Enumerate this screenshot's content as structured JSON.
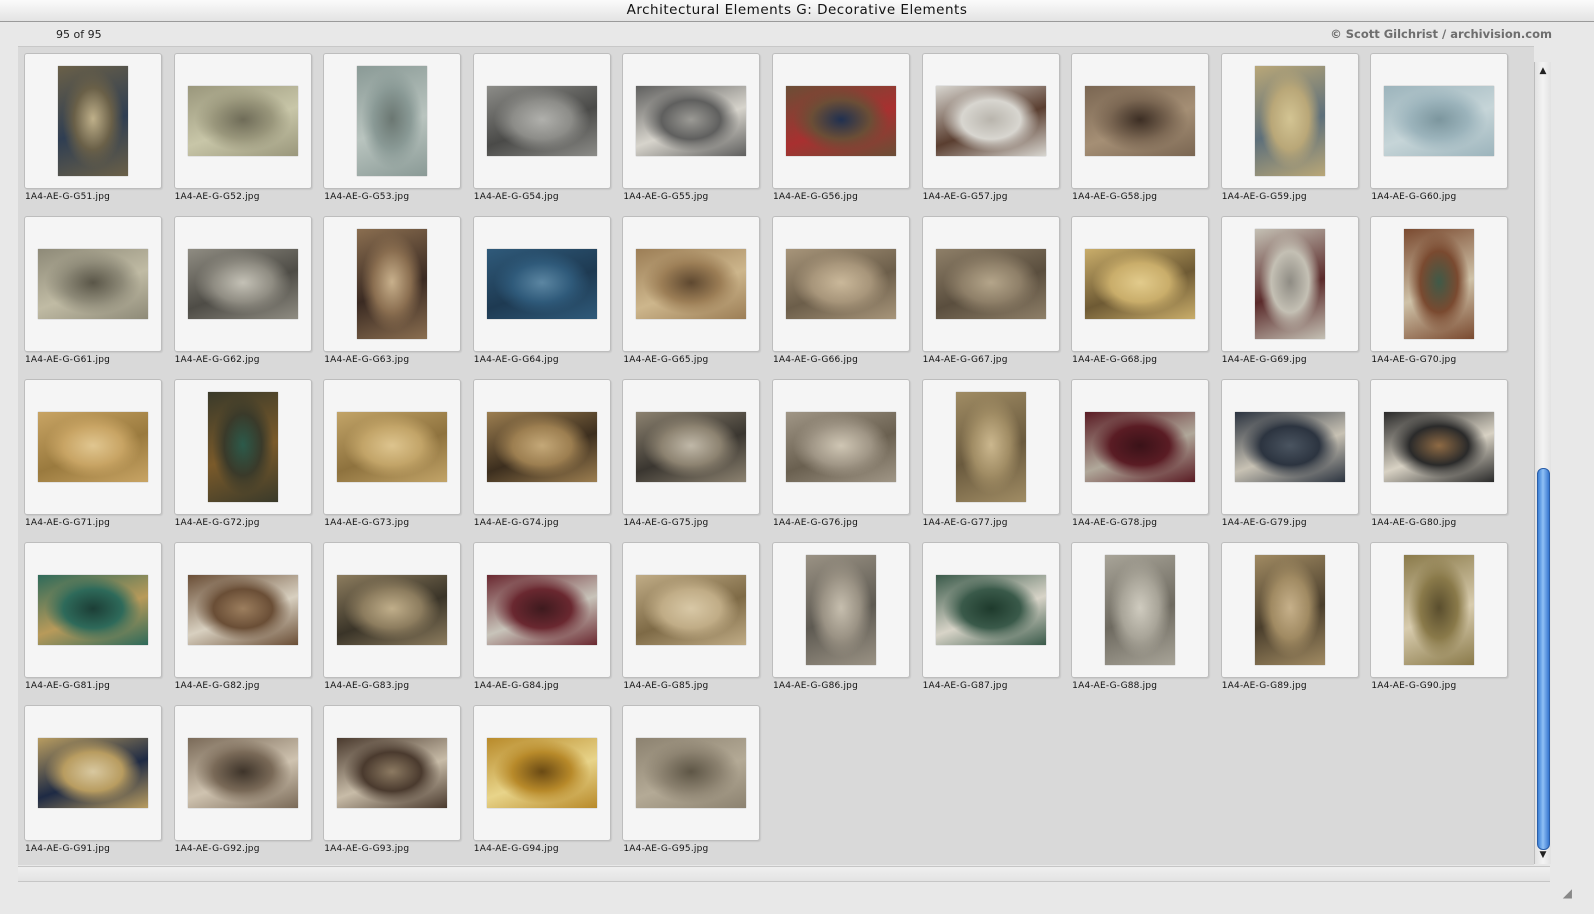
{
  "window": {
    "title": "Architectural Elements G: Decorative Elements"
  },
  "infobar": {
    "count": "95 of 95",
    "credit": "© Scott Gilchrist / archivision.com"
  },
  "scrollbar": {
    "up_glyph": "▲",
    "down_glyph": "▼",
    "resize_glyph": "◢"
  },
  "thumbnails": [
    {
      "file": "1A4-AE-G-G51.jpg",
      "shape": "port",
      "colors": [
        "#6a6048",
        "#2f3e52",
        "#bfb08a"
      ]
    },
    {
      "file": "1A4-AE-G-G52.jpg",
      "shape": "land",
      "colors": [
        "#9a977c",
        "#c8c6a8",
        "#6f6c58"
      ]
    },
    {
      "file": "1A4-AE-G-G53.jpg",
      "shape": "port",
      "colors": [
        "#8a9a96",
        "#b9c4bf",
        "#6b7772"
      ]
    },
    {
      "file": "1A4-AE-G-G54.jpg",
      "shape": "land",
      "colors": [
        "#8c8c88",
        "#4a4a48",
        "#b0b0ac"
      ]
    },
    {
      "file": "1A4-AE-G-G55.jpg",
      "shape": "land",
      "colors": [
        "#5f5f5e",
        "#d7d4cc",
        "#9b9a95"
      ]
    },
    {
      "file": "1A4-AE-G-G56.jpg",
      "shape": "land",
      "colors": [
        "#6b4e36",
        "#a83030",
        "#203050"
      ]
    },
    {
      "file": "1A4-AE-G-G57.jpg",
      "shape": "land",
      "colors": [
        "#d8d6d0",
        "#5a3e30",
        "#b9b5ad"
      ]
    },
    {
      "file": "1A4-AE-G-G58.jpg",
      "shape": "land",
      "colors": [
        "#7a6652",
        "#a58f75",
        "#3c2e24"
      ]
    },
    {
      "file": "1A4-AE-G-G59.jpg",
      "shape": "port",
      "colors": [
        "#b9a778",
        "#5d6f7a",
        "#d3c493"
      ]
    },
    {
      "file": "1A4-AE-G-G60.jpg",
      "shape": "land",
      "colors": [
        "#9cb4bc",
        "#c6d5d8",
        "#7c969e"
      ]
    },
    {
      "file": "1A4-AE-G-G61.jpg",
      "shape": "land",
      "colors": [
        "#8e8a78",
        "#c0bba4",
        "#5a5648"
      ]
    },
    {
      "file": "1A4-AE-G-G62.jpg",
      "shape": "land",
      "colors": [
        "#8f8c82",
        "#4e4c46",
        "#c4c1b6"
      ]
    },
    {
      "file": "1A4-AE-G-G63.jpg",
      "shape": "port",
      "colors": [
        "#8a6e50",
        "#3a2a22",
        "#c8b08c"
      ]
    },
    {
      "file": "1A4-AE-G-G64.jpg",
      "shape": "land",
      "colors": [
        "#2f5a7a",
        "#1e3a52",
        "#5c86a2"
      ]
    },
    {
      "file": "1A4-AE-G-G65.jpg",
      "shape": "land",
      "colors": [
        "#9c7e56",
        "#cdb68c",
        "#5e4830"
      ]
    },
    {
      "file": "1A4-AE-G-G66.jpg",
      "shape": "land",
      "colors": [
        "#a7957a",
        "#6c5e4a",
        "#cab89a"
      ]
    },
    {
      "file": "1A4-AE-G-G67.jpg",
      "shape": "land",
      "colors": [
        "#8e7f68",
        "#5a4e3e",
        "#b4a58a"
      ]
    },
    {
      "file": "1A4-AE-G-G68.jpg",
      "shape": "land",
      "colors": [
        "#c9ad6a",
        "#6e5a34",
        "#e2cb8c"
      ]
    },
    {
      "file": "1A4-AE-G-G69.jpg",
      "shape": "port",
      "colors": [
        "#c4c0b4",
        "#5a2a2a",
        "#8f8c84"
      ]
    },
    {
      "file": "1A4-AE-G-G70.jpg",
      "shape": "port",
      "colors": [
        "#7a4a30",
        "#cfc2a8",
        "#3f5a48"
      ]
    },
    {
      "file": "1A4-AE-G-G71.jpg",
      "shape": "land",
      "colors": [
        "#c8a464",
        "#9a7a3e",
        "#e0c690"
      ]
    },
    {
      "file": "1A4-AE-G-G72.jpg",
      "shape": "port",
      "colors": [
        "#3a3a2a",
        "#7a5a2a",
        "#2c5a4a"
      ]
    },
    {
      "file": "1A4-AE-G-G73.jpg",
      "shape": "land",
      "colors": [
        "#c2a468",
        "#8e723e",
        "#ddc48e"
      ]
    },
    {
      "file": "1A4-AE-G-G74.jpg",
      "shape": "land",
      "colors": [
        "#9c7e50",
        "#3c2e1e",
        "#c4a878"
      ]
    },
    {
      "file": "1A4-AE-G-G75.jpg",
      "shape": "land",
      "colors": [
        "#8c8270",
        "#3a3630",
        "#c0b8a8"
      ]
    },
    {
      "file": "1A4-AE-G-G76.jpg",
      "shape": "land",
      "colors": [
        "#a09686",
        "#6a6050",
        "#cfc6b4"
      ]
    },
    {
      "file": "1A4-AE-G-G77.jpg",
      "shape": "port",
      "colors": [
        "#a08c64",
        "#6a5a3e",
        "#cbb78e"
      ]
    },
    {
      "file": "1A4-AE-G-G78.jpg",
      "shape": "land",
      "colors": [
        "#5a1c24",
        "#b0a89a",
        "#3a1218"
      ]
    },
    {
      "file": "1A4-AE-G-G79.jpg",
      "shape": "land",
      "colors": [
        "#2c3440",
        "#c8c2b4",
        "#4a5460"
      ]
    },
    {
      "file": "1A4-AE-G-G80.jpg",
      "shape": "land",
      "colors": [
        "#2a2a2a",
        "#d8d2c4",
        "#8e6a44"
      ]
    },
    {
      "file": "1A4-AE-G-G81.jpg",
      "shape": "land",
      "colors": [
        "#2e6a5a",
        "#b89a5a",
        "#1c3e36"
      ]
    },
    {
      "file": "1A4-AE-G-G82.jpg",
      "shape": "land",
      "colors": [
        "#6a4e36",
        "#d8d0c0",
        "#9c7e5e"
      ]
    },
    {
      "file": "1A4-AE-G-G83.jpg",
      "shape": "land",
      "colors": [
        "#8c7c5e",
        "#3a3428",
        "#c0ae8a"
      ]
    },
    {
      "file": "1A4-AE-G-G84.jpg",
      "shape": "land",
      "colors": [
        "#6a2830",
        "#c8c4ba",
        "#3e1a1e"
      ]
    },
    {
      "file": "1A4-AE-G-G85.jpg",
      "shape": "land",
      "colors": [
        "#c0ac86",
        "#7e6a46",
        "#d8c8a6"
      ]
    },
    {
      "file": "1A4-AE-G-G86.jpg",
      "shape": "port",
      "colors": [
        "#9a9284",
        "#5e5a52",
        "#c6beae"
      ]
    },
    {
      "file": "1A4-AE-G-G87.jpg",
      "shape": "land",
      "colors": [
        "#3a5a4a",
        "#d8d4c8",
        "#1e3a2c"
      ]
    },
    {
      "file": "1A4-AE-G-G88.jpg",
      "shape": "port",
      "colors": [
        "#a8a498",
        "#6e6a60",
        "#cfcbbf"
      ]
    },
    {
      "file": "1A4-AE-G-G89.jpg",
      "shape": "port",
      "colors": [
        "#a08a62",
        "#4a3e2c",
        "#c6b08a"
      ]
    },
    {
      "file": "1A4-AE-G-G90.jpg",
      "shape": "port",
      "colors": [
        "#8a7a4a",
        "#d8ccae",
        "#5a4e2e"
      ]
    },
    {
      "file": "1A4-AE-G-G91.jpg",
      "shape": "land",
      "colors": [
        "#b89c60",
        "#1e2a44",
        "#d8c8a0"
      ]
    },
    {
      "file": "1A4-AE-G-G92.jpg",
      "shape": "land",
      "colors": [
        "#7a6a58",
        "#cfc3b0",
        "#3e342a"
      ]
    },
    {
      "file": "1A4-AE-G-G93.jpg",
      "shape": "land",
      "colors": [
        "#4a3a2e",
        "#c8bca8",
        "#8c7a62"
      ]
    },
    {
      "file": "1A4-AE-G-G94.jpg",
      "shape": "land",
      "colors": [
        "#b88a2a",
        "#e8d48a",
        "#6a4a14"
      ]
    },
    {
      "file": "1A4-AE-G-G95.jpg",
      "shape": "land",
      "colors": [
        "#8c8270",
        "#b4aa96",
        "#5e5646"
      ]
    }
  ]
}
